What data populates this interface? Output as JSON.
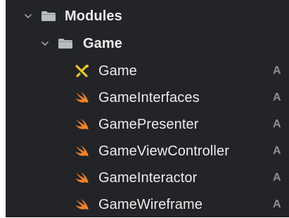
{
  "navigator": {
    "items": [
      {
        "label": "Modules",
        "type": "group",
        "expanded": true,
        "icon": "folder-icon"
      },
      {
        "label": "Game",
        "type": "group",
        "expanded": true,
        "icon": "folder-icon"
      },
      {
        "label": "Game",
        "type": "file",
        "icon": "xib-icon",
        "status": "A"
      },
      {
        "label": "GameInterfaces",
        "type": "file",
        "icon": "swift-icon",
        "status": "A"
      },
      {
        "label": "GamePresenter",
        "type": "file",
        "icon": "swift-icon",
        "status": "A"
      },
      {
        "label": "GameViewController",
        "type": "file",
        "icon": "swift-icon",
        "status": "A"
      },
      {
        "label": "GameInteractor",
        "type": "file",
        "icon": "swift-icon",
        "status": "A"
      },
      {
        "label": "GameWireframe",
        "type": "file",
        "icon": "swift-icon",
        "status": "A"
      }
    ]
  },
  "colors": {
    "background": "#232427",
    "folder": "#b8bcc2",
    "swift": "#f0822a",
    "xib": "#e8c531",
    "status": "#8e8e93"
  }
}
